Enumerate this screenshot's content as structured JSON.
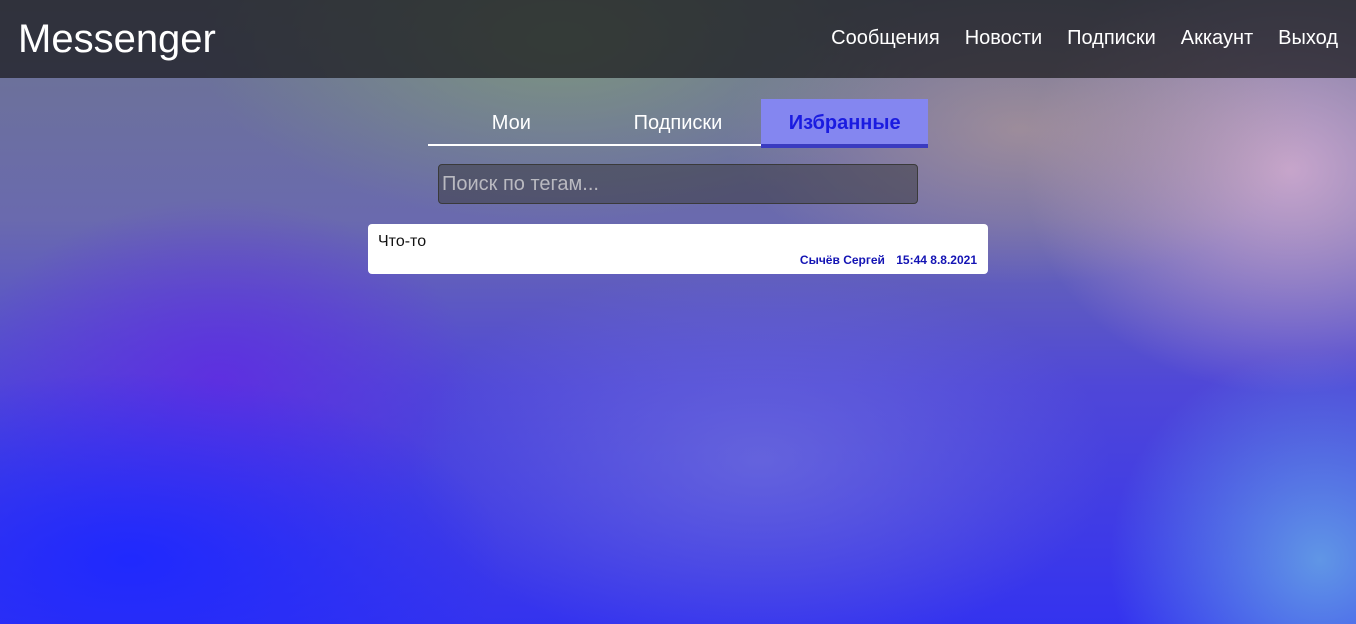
{
  "brand": "Messenger",
  "nav": {
    "messages": "Сообщения",
    "news": "Новости",
    "subscriptions": "Подписки",
    "account": "Аккаунт",
    "logout": "Выход"
  },
  "tabs": {
    "mine": "Мои",
    "subscriptions": "Подписки",
    "favorites": "Избранные",
    "active": "favorites"
  },
  "search": {
    "placeholder": "Поиск по тегам...",
    "value": ""
  },
  "posts": [
    {
      "text": "Что-то",
      "author": "Сычёв Сергей",
      "datetime": "15:44 8.8.2021"
    }
  ],
  "colors": {
    "active_tab_bg": "#8486f0",
    "active_tab_text": "#1a1be0",
    "meta_text": "#1414b4"
  }
}
